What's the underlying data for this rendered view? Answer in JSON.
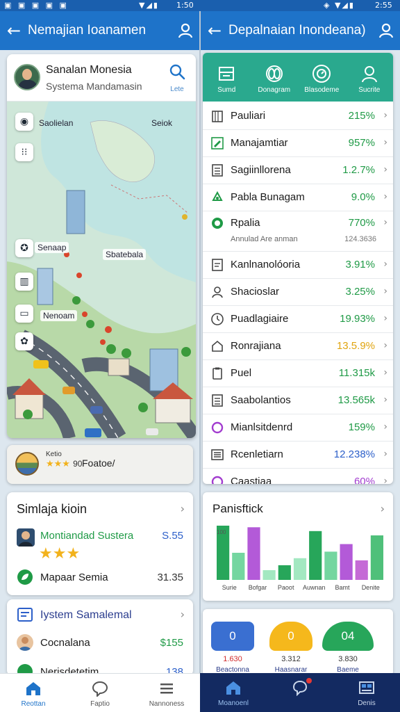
{
  "status_bar": {
    "left": {
      "time": "1:50"
    },
    "right": {
      "time": "2:55"
    }
  },
  "left_screen": {
    "appbar": {
      "title": "Nemajian Ioanamen"
    },
    "map_card": {
      "title": "Sanalan Monesia",
      "subtitle": "Systema Mandamasin",
      "search_label": "Lete",
      "labels": {
        "top_left": "Saolielan",
        "top_right": "Seiok",
        "mid_left": "Senaap",
        "center": "Sbatebala",
        "lower_left": "Nenoam"
      }
    },
    "rating_strip": {
      "small_label": "Ketio",
      "rating_number": "90",
      "stars": "★★★",
      "name": "Foatoe/"
    },
    "list_card_1": {
      "title": "Simlaja kioin",
      "items": [
        {
          "name": "Montiandad Sustera",
          "rating": "★★★",
          "value": "S.55"
        },
        {
          "name": "Mapaar Semia",
          "value": "31.35"
        }
      ]
    },
    "list_card_2": {
      "title": "Iystem Samalemal",
      "items": [
        {
          "name": "Cocnalana",
          "value": "$155"
        },
        {
          "name": "Nerisdetetim",
          "value": "138"
        }
      ]
    },
    "bottom_nav": [
      {
        "label": "Reottan",
        "icon": "home-icon",
        "active": true
      },
      {
        "label": "Faptio",
        "icon": "chat-bubble-icon",
        "active": false
      },
      {
        "label": "Nannoness",
        "icon": "menu-icon",
        "active": false
      }
    ]
  },
  "right_screen": {
    "appbar": {
      "title": "Depalnaian Inondeana)"
    },
    "tabs": [
      {
        "label": "Sumd",
        "icon": "storefront-icon"
      },
      {
        "label": "Donagram",
        "icon": "orbit-icon"
      },
      {
        "label": "Blasodeme",
        "icon": "clock-icon"
      },
      {
        "label": "Sucrite",
        "icon": "person-icon"
      }
    ],
    "stats": [
      {
        "name": "Pauliari",
        "value": "215%",
        "tone": "green",
        "icon": "building-icon"
      },
      {
        "name": "Manajamtiar",
        "value": "957%",
        "tone": "green",
        "icon": "pencil-icon"
      },
      {
        "name": "Sagiinllorena",
        "value": "1.2.7%",
        "tone": "green",
        "icon": "grid-icon"
      },
      {
        "name": "Pabla Bunagam",
        "value": "9.0%",
        "tone": "green",
        "icon": "recycle-icon"
      },
      {
        "name": "Rpalia",
        "sub_label": "Annulad Are anman",
        "sub_value": "124.3636",
        "value": "770%",
        "tone": "green",
        "icon": "green-dot-icon"
      },
      {
        "name": "Kanlnanolóoria",
        "value": "3.91%",
        "tone": "green",
        "icon": "document-icon"
      },
      {
        "name": "Shacioslar",
        "value": "3.25%",
        "tone": "green",
        "icon": "person-icon"
      },
      {
        "name": "Puadlagiaire",
        "value": "19.93%",
        "tone": "green",
        "icon": "clock-icon"
      },
      {
        "name": "Ronrajiana",
        "value": "13.5.9%",
        "tone": "yellow",
        "icon": "house-icon"
      },
      {
        "name": "Puel",
        "value": "11.315k",
        "tone": "green",
        "icon": "clipboard-icon"
      },
      {
        "name": "Saabolantios",
        "value": "13.565k",
        "tone": "green",
        "icon": "list-icon"
      },
      {
        "name": "Mianlsitdenrd",
        "value": "159%",
        "tone": "green",
        "icon": "purple-ring-icon"
      },
      {
        "name": "Rcenletiarn",
        "value": "12.238%",
        "tone": "blue",
        "icon": "list-box-icon"
      },
      {
        "name": "Caastiaa",
        "value": "60%",
        "tone": "purple",
        "icon": "purple-ring-icon"
      }
    ],
    "chart_card": {
      "title": "Panisftick"
    },
    "summary": [
      {
        "tile_value": "0",
        "value": "1.630",
        "label": "Beactonna",
        "color": "#3a6fd1",
        "value_color": "#d12b2b"
      },
      {
        "tile_value": "0",
        "value": "3.312",
        "label": "Haasnarar",
        "color": "#f5b81c",
        "value_color": "#333333"
      },
      {
        "tile_value": "04",
        "value": "3.830",
        "label": "Baeme",
        "color": "#27a65a",
        "value_color": "#333333"
      }
    ],
    "bottom_nav": [
      {
        "label": "Moanoenl",
        "icon": "home-icon",
        "active": true
      },
      {
        "label": "",
        "icon": "notification-bubble-icon",
        "active": false
      },
      {
        "label": "Denis",
        "icon": "layout-icon",
        "active": false
      }
    ]
  },
  "chart_data": {
    "type": "bar",
    "title": "Panisftick",
    "ylim": [
      0,
      120
    ],
    "y_tick_label": "100",
    "categories": [
      "Surie",
      "Bofgar",
      "Paoot",
      "Auwnan",
      "Bamt",
      "Denite"
    ],
    "bars": [
      {
        "category": "Surie",
        "value": 100,
        "color": "#27a65a"
      },
      {
        "category": "Surie",
        "value": 50,
        "color": "#74d6a0"
      },
      {
        "category": "Bofgar",
        "value": 97,
        "color": "#b35ad8"
      },
      {
        "category": "Bofgar",
        "value": 18,
        "color": "#a3e8c1"
      },
      {
        "category": "Paoot",
        "value": 27,
        "color": "#27a65a"
      },
      {
        "category": "Auwnan",
        "value": 40,
        "color": "#a3e8c1"
      },
      {
        "category": "Auwnan",
        "value": 90,
        "color": "#27a65a"
      },
      {
        "category": "Bamt",
        "value": 52,
        "color": "#74d6a0"
      },
      {
        "category": "Bamt",
        "value": 66,
        "color": "#b35ad8"
      },
      {
        "category": "Denite",
        "value": 36,
        "color": "#c56ad6"
      },
      {
        "category": "Denite",
        "value": 82,
        "color": "#4fc07a"
      }
    ]
  },
  "colors": {
    "appbar": "#1e73c9",
    "green": "#1f9a46",
    "yellow": "#e0a40f",
    "blue": "#2c5fc9",
    "purple": "#a23ccf",
    "teal": "#2aa98e",
    "nav_dark": "#132a61"
  }
}
